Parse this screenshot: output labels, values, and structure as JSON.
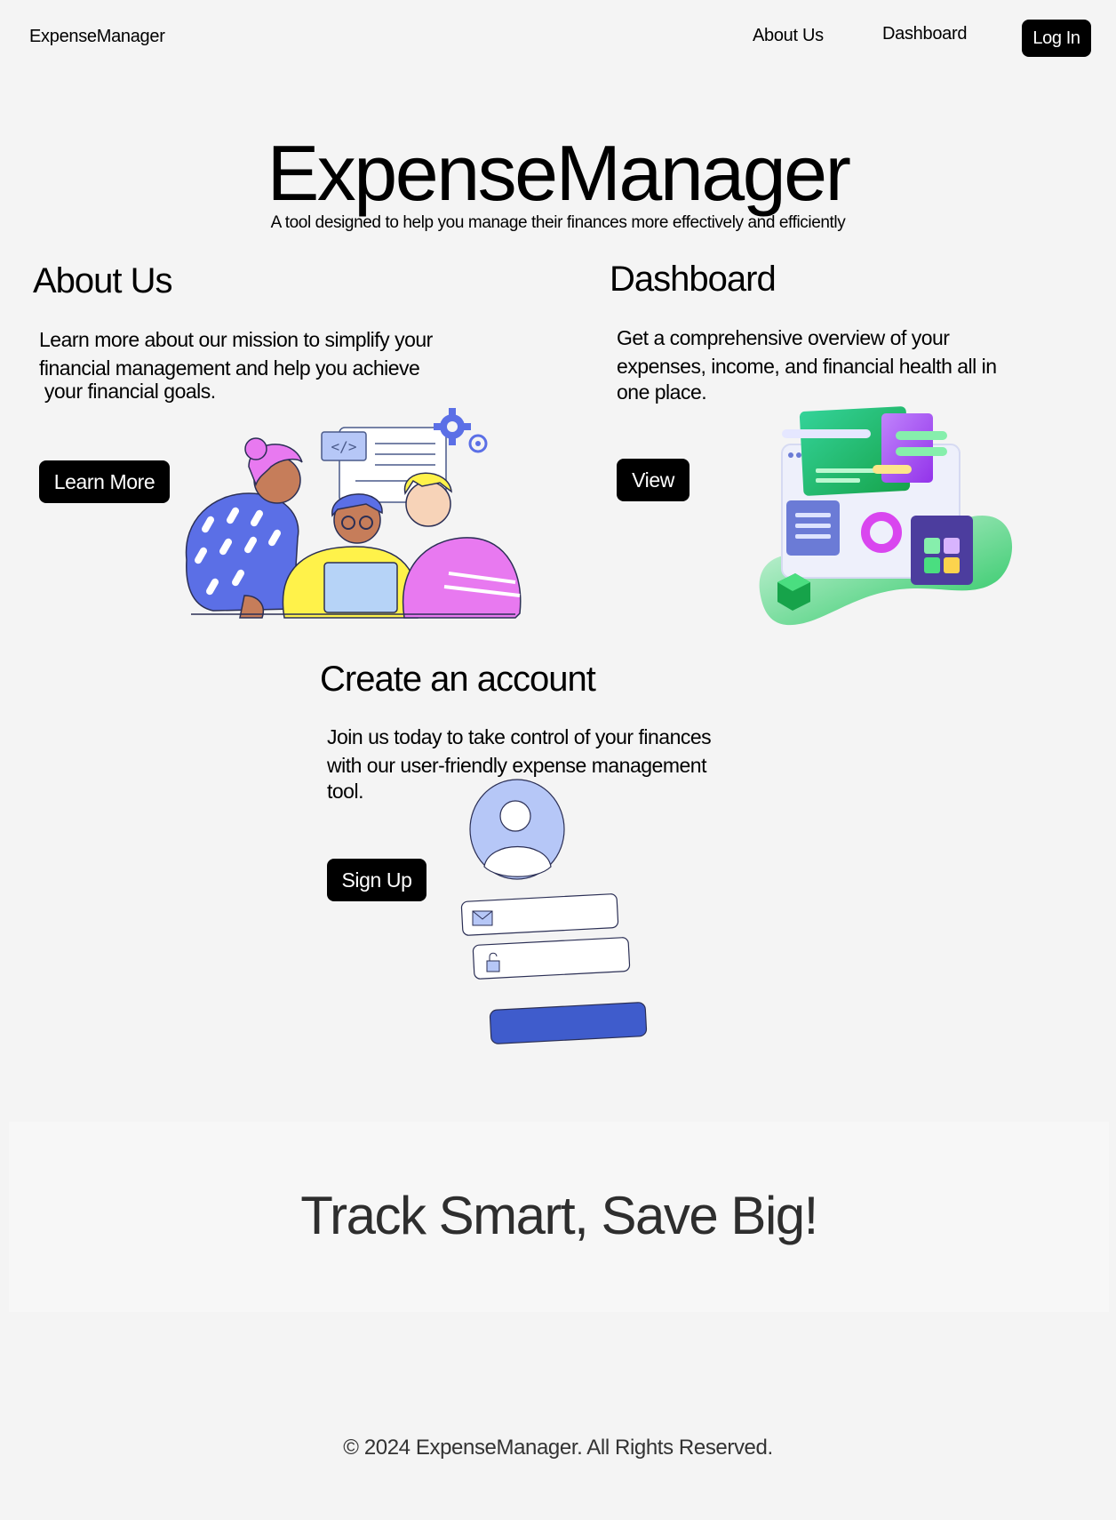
{
  "nav": {
    "brand": "ExpenseManager",
    "links": [
      {
        "label": "About Us"
      },
      {
        "label": "Dashboard"
      }
    ],
    "login_label": "Log In"
  },
  "hero": {
    "title": "ExpenseManager",
    "subtitle": "A tool designed to help you manage their finances more effectively and efficiently"
  },
  "about": {
    "heading": "About Us",
    "lines": [
      "Learn more about our mission to simplify your",
      "financial management and help you achieve",
      " your financial goals."
    ],
    "button_label": "Learn More"
  },
  "dashboard": {
    "heading": "Dashboard",
    "lines": [
      "Get a comprehensive overview of your",
      "expenses, income, and financial health all in",
      "one place."
    ],
    "button_label": "View"
  },
  "signup": {
    "heading": "Create an account",
    "lines": [
      "Join us today to take control of your finances",
      "with our user-friendly expense management",
      "tool."
    ],
    "button_label": "Sign Up"
  },
  "banner": {
    "text": "Track Smart, Save Big!"
  },
  "footer": {
    "text": "© 2024 ExpenseManager. All Rights Reserved."
  },
  "colors": {
    "background": "#f4f4f4",
    "button_bg": "#000000",
    "button_text": "#ffffff",
    "banner_bg": "#f7f7f7",
    "illustration_blue": "#5b6fe6",
    "illustration_pink": "#e879f0",
    "illustration_yellow": "#fff24a",
    "illustration_green": "#22c55e",
    "form_button_blue": "#3f5ccc"
  },
  "icons": {
    "code_tag": "code-icon",
    "gear": "gear-icon",
    "mail": "mail-icon",
    "lock": "lock-icon",
    "avatar": "user-avatar-icon"
  }
}
